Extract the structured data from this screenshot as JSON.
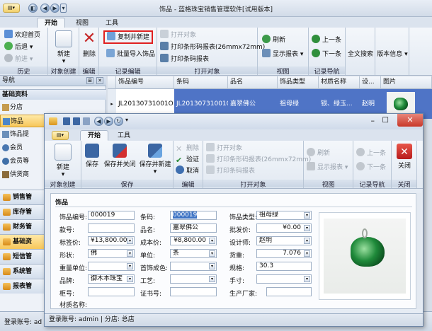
{
  "app": {
    "title": "饰品 - 蓝格珠宝销售管理软件[试用版本]"
  },
  "main_tabs": [
    "开始",
    "视图",
    "工具"
  ],
  "ribbon": {
    "history": {
      "label": "历史",
      "items": [
        "欢迎首页",
        "后退",
        "前进"
      ]
    },
    "create": {
      "label": "对象创建",
      "new": "新建"
    },
    "edit": {
      "label": "编辑",
      "delete": "删除"
    },
    "record": {
      "label": "记录编辑",
      "copy_new": "复制并新建",
      "batch_import": "批量导入饰品"
    },
    "print": {
      "label": "打开对象",
      "open": "打开对象",
      "print_barcode": "打印条形码报表(26mmx72mm)",
      "print_barcode2": "打印条码报表"
    },
    "view": {
      "label": "视图",
      "refresh": "刷新",
      "show_report": "显示报表"
    },
    "nav": {
      "label": "记录导航",
      "prev": "上一条",
      "next": "下一条"
    },
    "search": "全文搜索",
    "version": "版本信息"
  },
  "nav": {
    "header": "导航",
    "section": "基础资料",
    "items": [
      "分店",
      "饰品",
      "饰品提",
      "会员",
      "会员等",
      "供货商"
    ],
    "groups": [
      "销售管",
      "库存管",
      "财务管",
      "基础资",
      "短信管",
      "系统管",
      "报表管"
    ]
  },
  "grid": {
    "columns": [
      "饰品编号",
      "条码",
      "品名",
      "饰品类型",
      "材质名称",
      "设...",
      "图片"
    ],
    "row": [
      "JL20130731001O",
      "JL201307310010",
      "嘉翠佛公",
      "祖母绿",
      "银、绿玉...",
      "赵明"
    ]
  },
  "status": {
    "login": "登录账号: ad"
  },
  "dialog": {
    "tabs": [
      "开始",
      "工具"
    ],
    "ribbon": {
      "create": {
        "label": "对象创建",
        "new": "新建"
      },
      "save": {
        "label": "保存",
        "save": "保存",
        "save_close": "保存并关闭",
        "save_new": "保存并新建"
      },
      "edit": {
        "label": "编辑",
        "delete": "删除",
        "verify": "验证",
        "cancel": "取消"
      },
      "open": {
        "label": "打开对象",
        "open": "打开对象",
        "barcode": "打印条形码报表(26mmx72mm)",
        "barcode2": "打印条码报表"
      },
      "view": {
        "label": "视图",
        "refresh": "刷新",
        "show_report": "显示报表"
      },
      "nav": {
        "label": "记录导航",
        "prev": "上一条",
        "next": "下一条"
      },
      "close": {
        "label": "关闭",
        "close": "关闭"
      }
    },
    "form": {
      "section": "饰品",
      "code_label": "饰品编号:",
      "code": "000019",
      "barcode_label": "条码:",
      "barcode": "000019",
      "type_label": "饰品类型:",
      "type": "祖母绿",
      "style_label": "款号:",
      "style": "",
      "name_label": "品名:",
      "name": "嘉翠佛公",
      "wholesale_label": "批发价:",
      "wholesale": "¥0.00",
      "tag_label": "标签价:",
      "tag": "¥13,800.00",
      "cost_label": "成本价:",
      "cost": "¥8,800.00",
      "designer_label": "设计师:",
      "designer": "赵明",
      "shape_label": "形状:",
      "shape": "佛",
      "unit_label": "单位:",
      "unit": "条",
      "weight_label": "货重:",
      "weight": "7.076",
      "weight_unit_label": "重量单位:",
      "weight_unit": "",
      "color_label": "首饰成色:",
      "color": "",
      "spec_label": "规格:",
      "spec": "30.3",
      "brand_label": "品牌:",
      "brand": "御木本珠宝",
      "craft_label": "工艺:",
      "craft": "",
      "hand_label": "手寸:",
      "hand": "",
      "cabinet_label": "柜号:",
      "cabinet": "",
      "cert_label": "证书号:",
      "cert": "",
      "maker_label": "生产厂家:",
      "maker": "",
      "material_label": "材质名称:",
      "material": ""
    },
    "status": "登录账号: admin  |  分店: 总店"
  }
}
